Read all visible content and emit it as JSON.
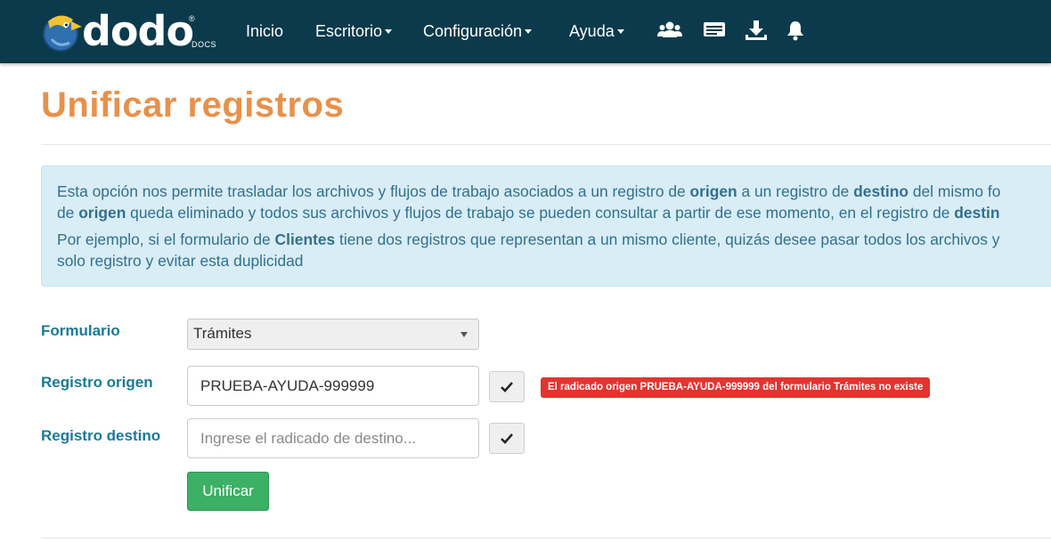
{
  "navbar": {
    "logo": {
      "word": "dodo",
      "registered": "®",
      "suffix": "DOCS"
    },
    "links": [
      {
        "label": "Inicio",
        "dropdown": false
      },
      {
        "label": "Escritorio",
        "dropdown": true
      },
      {
        "label": "Configuración",
        "dropdown": true
      },
      {
        "label": "Ayuda",
        "dropdown": true
      }
    ],
    "icons": [
      "users-icon",
      "id-card-icon",
      "download-icon",
      "bell-icon"
    ],
    "background_color": "#0b3a4c"
  },
  "page": {
    "title": "Unificar registros",
    "title_color": "#e8914a"
  },
  "alert": {
    "p1": {
      "t1": "Esta opción nos permite trasladar los archivos y flujos de trabajo asociados a un registro de ",
      "b1": "origen",
      "t2": " a un registro de ",
      "b2": "destino",
      "t3": " del mismo fo",
      "t4": "de ",
      "b3": "origen",
      "t5": " queda eliminado y todos sus archivos y flujos de trabajo se pueden consultar a partir de ese momento, en el registro de ",
      "b4": "destin"
    },
    "p2": {
      "t1": "Por ejemplo, si el formulario de ",
      "b1": "Clientes",
      "t2": " tiene dos registros que representan a un mismo cliente, quizás desee pasar todos los archivos y",
      "t3": "solo registro y evitar esta duplicidad"
    }
  },
  "form": {
    "formulario": {
      "label": "Formulario",
      "value": "Trámites"
    },
    "origen": {
      "label": "Registro origen",
      "value": "PRUEBA-AYUDA-999999"
    },
    "destino": {
      "label": "Registro destino",
      "value": "",
      "placeholder": "Ingrese el radicado de destino..."
    },
    "error": "El radicado origen PRUEBA-AYUDA-999999 del formulario Trámites no existe",
    "submit_label": "Unificar"
  }
}
